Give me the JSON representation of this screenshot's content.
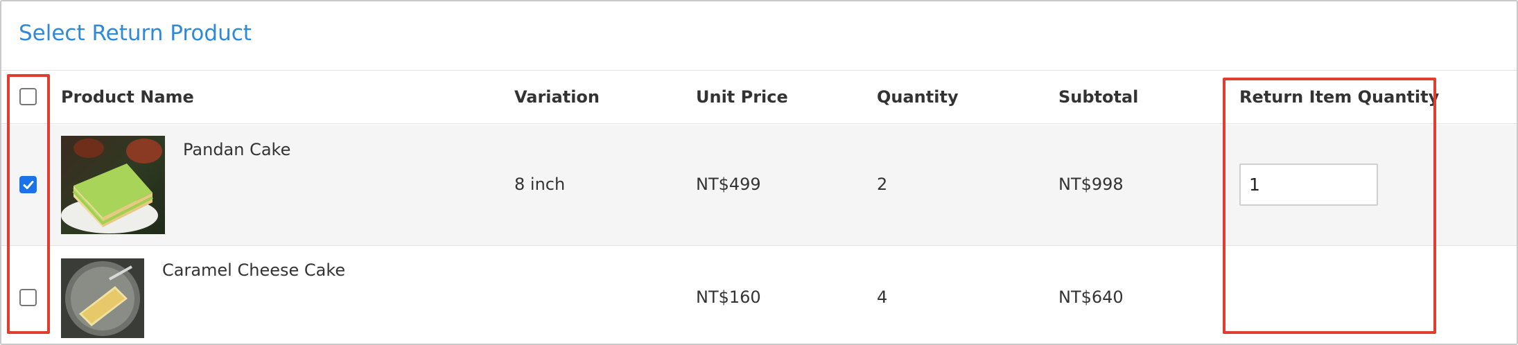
{
  "panel": {
    "title": "Select Return Product"
  },
  "table": {
    "headers": {
      "product_name": "Product Name",
      "variation": "Variation",
      "unit_price": "Unit Price",
      "quantity": "Quantity",
      "subtotal": "Subtotal",
      "return_item_quantity": "Return Item Quantity"
    },
    "select_all_checked": false,
    "rows": [
      {
        "checked": true,
        "name": "Pandan Cake",
        "variation": "8 inch",
        "unit_price": "NT$499",
        "quantity": "2",
        "subtotal": "NT$998",
        "return_quantity": "1"
      },
      {
        "checked": false,
        "name": "Caramel Cheese Cake",
        "variation": "",
        "unit_price": "NT$160",
        "quantity": "4",
        "subtotal": "NT$640",
        "return_quantity": ""
      }
    ]
  },
  "colors": {
    "title": "#2e8ad8",
    "highlight": "#e03d2f",
    "checkbox_checked": "#1a73e8"
  }
}
